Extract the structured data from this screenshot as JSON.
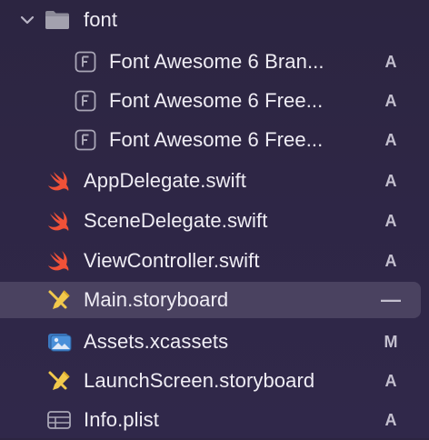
{
  "navigator": {
    "folder": {
      "label": "font",
      "icon": "folder-icon",
      "expanded": true
    },
    "items": [
      {
        "label": "Font Awesome 6 Bran...",
        "icon": "font-file-icon",
        "status": "A",
        "selected": false
      },
      {
        "label": "Font Awesome 6 Free...",
        "icon": "font-file-icon",
        "status": "A",
        "selected": false
      },
      {
        "label": "Font Awesome 6 Free...",
        "icon": "font-file-icon",
        "status": "A",
        "selected": false
      },
      {
        "label": "AppDelegate.swift",
        "icon": "swift-icon",
        "status": "A",
        "selected": false
      },
      {
        "label": "SceneDelegate.swift",
        "icon": "swift-icon",
        "status": "A",
        "selected": false
      },
      {
        "label": "ViewController.swift",
        "icon": "swift-icon",
        "status": "A",
        "selected": false
      },
      {
        "label": "Main.storyboard",
        "icon": "storyboard-icon",
        "status": "—",
        "selected": true
      },
      {
        "label": "Assets.xcassets",
        "icon": "asset-catalog-icon",
        "status": "M",
        "selected": false
      },
      {
        "label": "LaunchScreen.storyboard",
        "icon": "storyboard-icon",
        "status": "A",
        "selected": false
      },
      {
        "label": "Info.plist",
        "icon": "plist-icon",
        "status": "A",
        "selected": false
      }
    ]
  },
  "colors": {
    "background": "#2e2645",
    "selection": "#4a4260",
    "swift": "#f05138",
    "storyboard": "#f2c94c",
    "asset": "#4a90d9",
    "status": "#c4c0cf"
  }
}
